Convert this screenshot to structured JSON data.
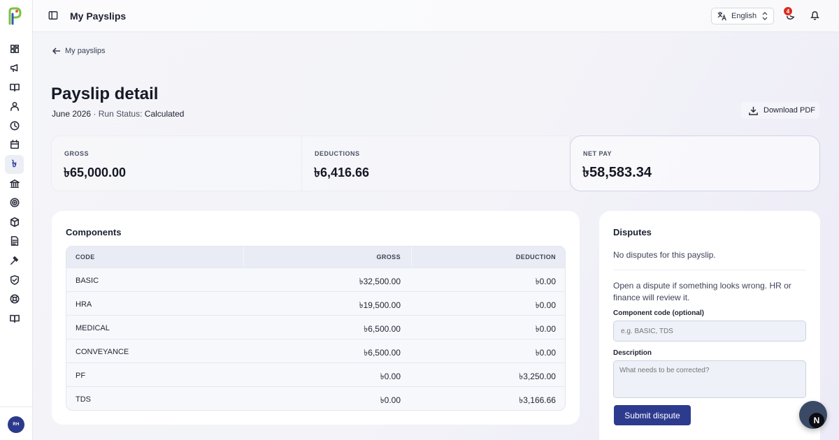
{
  "topbar": {
    "title": "My Payslips",
    "language": "English",
    "notification_count": "4"
  },
  "sidebar": {
    "avatar_initials": "RH",
    "active_item_glyph": "৳",
    "items": [
      {
        "icon": "dashboard-icon"
      },
      {
        "icon": "megaphone-icon"
      },
      {
        "icon": "book-open-icon"
      },
      {
        "icon": "user-icon"
      },
      {
        "icon": "clock-icon"
      },
      {
        "icon": "calendar-icon"
      },
      {
        "icon": "taka-icon"
      },
      {
        "icon": "bank-icon"
      },
      {
        "icon": "target-icon"
      },
      {
        "icon": "box-icon"
      },
      {
        "icon": "document-icon"
      },
      {
        "icon": "gavel-icon"
      },
      {
        "icon": "shield-check-icon"
      },
      {
        "icon": "lifebuoy-icon"
      },
      {
        "icon": "book-icon"
      }
    ]
  },
  "breadcrumb": {
    "back_label": "My payslips"
  },
  "page": {
    "title": "Payslip detail",
    "period": "June 2026",
    "separator": " · ",
    "run_status_label": "Run Status: ",
    "run_status_value": "Calculated",
    "download_label": "Download PDF"
  },
  "stats": {
    "gross_label": "GROSS",
    "gross_value": "৳65,000.00",
    "deductions_label": "DEDUCTIONS",
    "deductions_value": "৳6,416.66",
    "net_label": "NET PAY",
    "net_value": "৳58,583.34"
  },
  "components": {
    "title": "Components",
    "headers": {
      "code": "CODE",
      "gross": "GROSS",
      "deduction": "DEDUCTION"
    },
    "rows": [
      {
        "code": "BASIC",
        "gross": "৳32,500.00",
        "deduction": "৳0.00"
      },
      {
        "code": "HRA",
        "gross": "৳19,500.00",
        "deduction": "৳0.00"
      },
      {
        "code": "MEDICAL",
        "gross": "৳6,500.00",
        "deduction": "৳0.00"
      },
      {
        "code": "CONVEYANCE",
        "gross": "৳6,500.00",
        "deduction": "৳0.00"
      },
      {
        "code": "PF",
        "gross": "৳0.00",
        "deduction": "৳3,250.00"
      },
      {
        "code": "TDS",
        "gross": "৳0.00",
        "deduction": "৳3,166.66"
      }
    ]
  },
  "disputes": {
    "title": "Disputes",
    "empty_text": "No disputes for this payslip.",
    "help_text": "Open a dispute if something looks wrong. HR or finance will review it.",
    "component_label": "Component code (optional)",
    "component_placeholder": "e.g. BASIC, TDS",
    "description_label": "Description",
    "description_placeholder": "What needs to be corrected?",
    "submit_label": "Submit dispute"
  },
  "fab": {
    "glyph": "N"
  },
  "colors": {
    "accent": "#2d3b8e",
    "badge": "#d92d20",
    "logo_green": "#7cc242",
    "logo_blue": "#2b5fb0"
  }
}
